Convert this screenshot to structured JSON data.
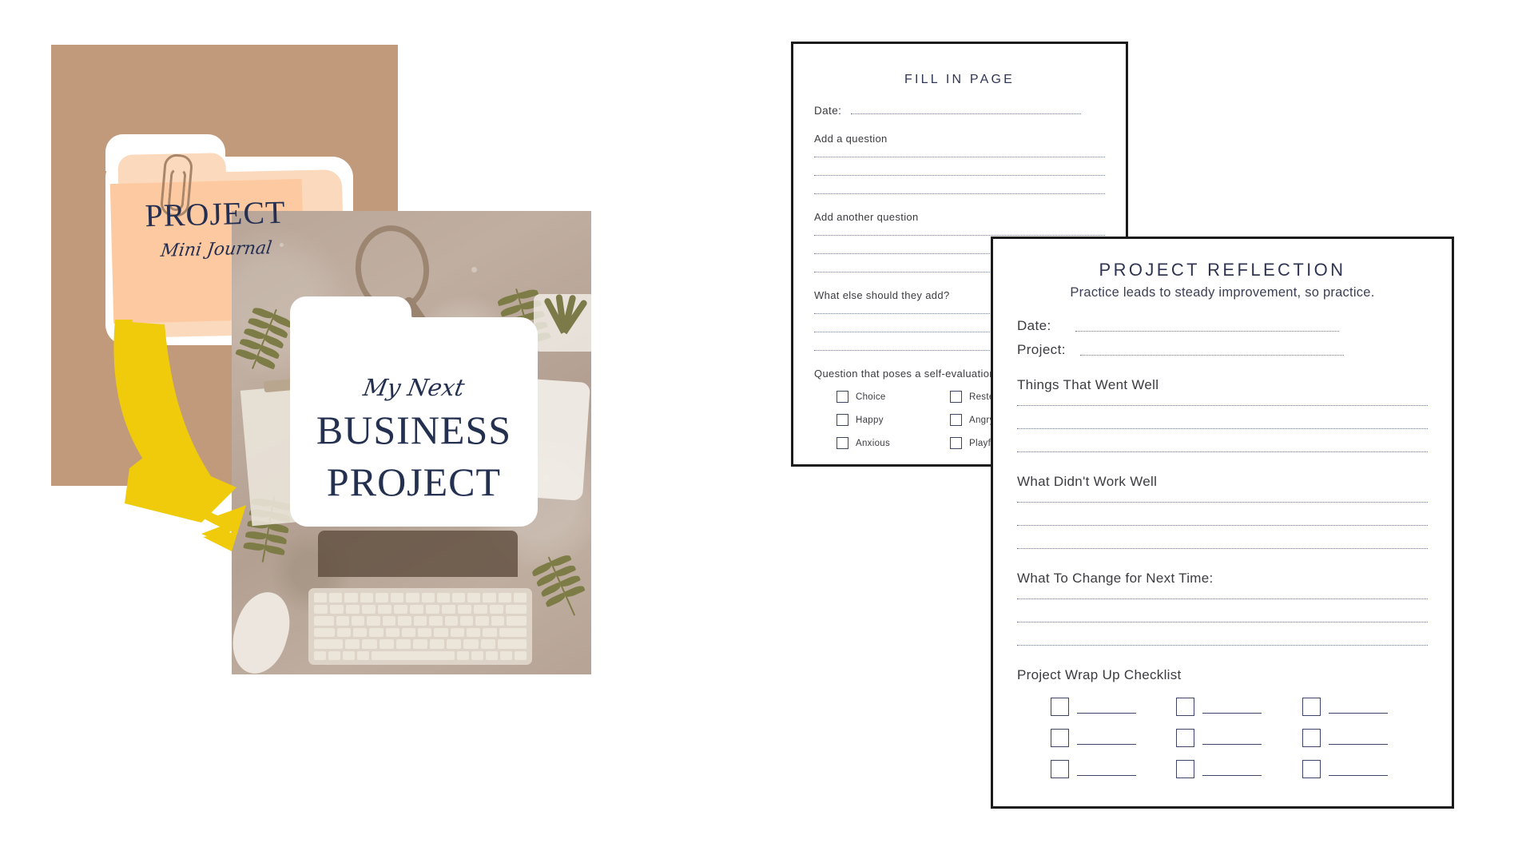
{
  "theme": {
    "tan": "#c19a7b",
    "apricot": "#fdc9a0",
    "peach_light": "#fbd9bd",
    "coral": "#f08b74",
    "navy": "#24304f",
    "yellow_arrow": "#efcb0b",
    "doc_border": "#1b1b1b",
    "ink": "#3b3b40"
  },
  "left": {
    "journal_cover": {
      "title": "PROJECT",
      "subtitle": "Mini Journal",
      "paperclip_icon": "paperclip-icon"
    },
    "business_cover": {
      "script_line": "My Next",
      "title_line_1": "BUSINESS",
      "title_line_2": "PROJECT",
      "photo_objects": [
        "magnifier-icon",
        "fern-leaf-icon",
        "succulent-plant-icon",
        "clipboard-icon",
        "phone-icon",
        "keyboard-icon",
        "mouse-icon",
        "laptop-icon"
      ]
    },
    "arrow": {
      "icon": "curved-down-right-arrow-icon"
    }
  },
  "right": {
    "fill_in_page": {
      "title": "FILL IN PAGE",
      "date_label": "Date:",
      "questions": [
        {
          "label": "Add a question",
          "lines": 3
        },
        {
          "label": "Add another question",
          "lines": 3
        },
        {
          "label": "What else should they add?",
          "lines": 3
        }
      ],
      "self_eval_label": "Question that poses a self-evaluation",
      "checkbox_options_left": [
        "Choice",
        "Happy",
        "Anxious"
      ],
      "checkbox_options_right": [
        "Rested",
        "Angry",
        "Playful"
      ]
    },
    "project_reflection": {
      "title": "PROJECT REFLECTION",
      "subtitle": "Practice leads to steady improvement, so practice.",
      "date_label": "Date:",
      "project_label": "Project:",
      "sections": [
        {
          "title": "Things That Went Well",
          "lines": 3
        },
        {
          "title": "What Didn't Work Well",
          "lines": 3
        },
        {
          "title": "What To Change for Next Time:",
          "lines": 3
        }
      ],
      "checklist_title": "Project Wrap Up Checklist",
      "checklist_rows": 3,
      "checklist_cols": 3
    },
    "arrow": {
      "icon": "curved-down-right-arrow-icon"
    }
  }
}
